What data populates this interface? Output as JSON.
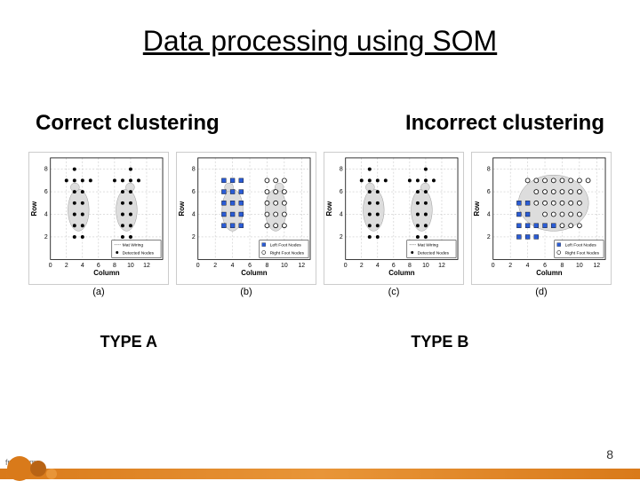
{
  "title": "Data processing using SOM",
  "subtitle_left": "Correct clustering",
  "subtitle_right": "Incorrect clustering",
  "type_a": "TYPE A",
  "type_b": "TYPE B",
  "page_number": "8",
  "attribution": "fppt.com",
  "axes": {
    "xlabel": "Column",
    "ylabel": "Row"
  },
  "legends": {
    "a": [
      "Mat Wiring",
      "Detected Nodes"
    ],
    "b": [
      "Left Foot Nodes",
      "Right Foot Nodes"
    ],
    "c": [
      "Mat Wiring",
      "Detected Nodes"
    ],
    "d": [
      "Left Foot Nodes",
      "Right Foot Nodes"
    ]
  },
  "plot_ids": {
    "a": "(a)",
    "b": "(b)",
    "c": "(c)",
    "d": "(d)"
  },
  "chart_data": [
    {
      "id": "a",
      "type": "scatter",
      "xlabel": "Column",
      "ylabel": "Row",
      "xlim": [
        0,
        14
      ],
      "ylim": [
        0,
        9
      ],
      "xticks": [
        0,
        2,
        4,
        6,
        8,
        10,
        12
      ],
      "yticks": [
        2,
        4,
        6,
        8
      ],
      "series": [
        {
          "name": "Mat Wiring",
          "marker": "line-grid",
          "x": [
            1,
            2,
            3,
            4,
            5,
            6,
            7,
            8,
            9,
            10,
            11,
            12,
            13
          ],
          "y": [
            1,
            2,
            3,
            4,
            5,
            6,
            7,
            8
          ]
        },
        {
          "name": "Detected Nodes (left footprint)",
          "marker": "dot",
          "points": [
            [
              3,
              2
            ],
            [
              4,
              2
            ],
            [
              3,
              3
            ],
            [
              4,
              3
            ],
            [
              3,
              4
            ],
            [
              4,
              4
            ],
            [
              3,
              5
            ],
            [
              4,
              5
            ],
            [
              3,
              6
            ],
            [
              4,
              6
            ],
            [
              3,
              7
            ],
            [
              4,
              7
            ],
            [
              2,
              7
            ],
            [
              3,
              8
            ],
            [
              5,
              7
            ]
          ]
        },
        {
          "name": "Detected Nodes (right footprint)",
          "marker": "dot",
          "points": [
            [
              9,
              2
            ],
            [
              10,
              2
            ],
            [
              9,
              3
            ],
            [
              10,
              3
            ],
            [
              9,
              4
            ],
            [
              10,
              4
            ],
            [
              9,
              5
            ],
            [
              10,
              5
            ],
            [
              9,
              6
            ],
            [
              10,
              6
            ],
            [
              9,
              7
            ],
            [
              10,
              7
            ],
            [
              11,
              7
            ],
            [
              8,
              7
            ],
            [
              10,
              8
            ]
          ]
        }
      ]
    },
    {
      "id": "b",
      "type": "scatter",
      "xlabel": "Column",
      "ylabel": "Row",
      "xlim": [
        0,
        13
      ],
      "ylim": [
        0,
        9
      ],
      "xticks": [
        0,
        2,
        4,
        6,
        8,
        10,
        12
      ],
      "yticks": [
        2,
        4,
        6,
        8
      ],
      "series": [
        {
          "name": "Left Foot Nodes",
          "marker": "square",
          "points": [
            [
              3,
              3
            ],
            [
              4,
              3
            ],
            [
              5,
              3
            ],
            [
              3,
              4
            ],
            [
              4,
              4
            ],
            [
              5,
              4
            ],
            [
              3,
              5
            ],
            [
              4,
              5
            ],
            [
              5,
              5
            ],
            [
              3,
              6
            ],
            [
              4,
              6
            ],
            [
              5,
              6
            ],
            [
              3,
              7
            ],
            [
              4,
              7
            ],
            [
              5,
              7
            ]
          ]
        },
        {
          "name": "Right Foot Nodes",
          "marker": "circle-open",
          "points": [
            [
              8,
              3
            ],
            [
              9,
              3
            ],
            [
              10,
              3
            ],
            [
              8,
              4
            ],
            [
              9,
              4
            ],
            [
              10,
              4
            ],
            [
              8,
              5
            ],
            [
              9,
              5
            ],
            [
              10,
              5
            ],
            [
              8,
              6
            ],
            [
              9,
              6
            ],
            [
              10,
              6
            ],
            [
              8,
              7
            ],
            [
              9,
              7
            ],
            [
              10,
              7
            ]
          ]
        }
      ]
    },
    {
      "id": "c",
      "type": "scatter",
      "xlabel": "Column",
      "ylabel": "Row",
      "xlim": [
        0,
        14
      ],
      "ylim": [
        0,
        9
      ],
      "xticks": [
        0,
        2,
        4,
        6,
        8,
        10,
        12
      ],
      "yticks": [
        2,
        4,
        6,
        8
      ],
      "series": [
        {
          "name": "Mat Wiring",
          "marker": "line-grid",
          "x": [
            1,
            2,
            3,
            4,
            5,
            6,
            7,
            8,
            9,
            10,
            11,
            12,
            13
          ],
          "y": [
            1,
            2,
            3,
            4,
            5,
            6,
            7,
            8
          ]
        },
        {
          "name": "Detected Nodes (left footprint)",
          "marker": "dot",
          "points": [
            [
              3,
              2
            ],
            [
              4,
              2
            ],
            [
              3,
              3
            ],
            [
              4,
              3
            ],
            [
              3,
              4
            ],
            [
              4,
              4
            ],
            [
              3,
              5
            ],
            [
              4,
              5
            ],
            [
              3,
              6
            ],
            [
              4,
              6
            ],
            [
              3,
              7
            ],
            [
              4,
              7
            ],
            [
              2,
              7
            ],
            [
              3,
              8
            ],
            [
              5,
              7
            ]
          ]
        },
        {
          "name": "Detected Nodes (right footprint)",
          "marker": "dot",
          "points": [
            [
              9,
              2
            ],
            [
              10,
              2
            ],
            [
              9,
              3
            ],
            [
              10,
              3
            ],
            [
              9,
              4
            ],
            [
              10,
              4
            ],
            [
              9,
              5
            ],
            [
              10,
              5
            ],
            [
              9,
              6
            ],
            [
              10,
              6
            ],
            [
              9,
              7
            ],
            [
              10,
              7
            ],
            [
              11,
              7
            ],
            [
              8,
              7
            ],
            [
              10,
              8
            ]
          ]
        }
      ]
    },
    {
      "id": "d",
      "type": "scatter",
      "xlabel": "Column",
      "ylabel": "Row",
      "xlim": [
        0,
        13
      ],
      "ylim": [
        0,
        9
      ],
      "xticks": [
        0,
        2,
        4,
        6,
        8,
        10,
        12
      ],
      "yticks": [
        2,
        4,
        6,
        8
      ],
      "series": [
        {
          "name": "Left Foot Nodes",
          "marker": "square",
          "points": [
            [
              3,
              2
            ],
            [
              4,
              2
            ],
            [
              5,
              2
            ],
            [
              6,
              3
            ],
            [
              7,
              3
            ],
            [
              3,
              3
            ],
            [
              4,
              3
            ],
            [
              5,
              3
            ],
            [
              3,
              4
            ],
            [
              4,
              4
            ],
            [
              3,
              5
            ],
            [
              4,
              5
            ]
          ]
        },
        {
          "name": "Right Foot Nodes",
          "marker": "circle-open",
          "points": [
            [
              8,
              3
            ],
            [
              9,
              3
            ],
            [
              10,
              3
            ],
            [
              6,
              4
            ],
            [
              7,
              4
            ],
            [
              8,
              4
            ],
            [
              9,
              4
            ],
            [
              10,
              4
            ],
            [
              5,
              5
            ],
            [
              6,
              5
            ],
            [
              7,
              5
            ],
            [
              8,
              5
            ],
            [
              9,
              5
            ],
            [
              10,
              5
            ],
            [
              5,
              6
            ],
            [
              6,
              6
            ],
            [
              7,
              6
            ],
            [
              8,
              6
            ],
            [
              9,
              6
            ],
            [
              10,
              6
            ],
            [
              4,
              7
            ],
            [
              5,
              7
            ],
            [
              6,
              7
            ],
            [
              7,
              7
            ],
            [
              8,
              7
            ],
            [
              9,
              7
            ],
            [
              10,
              7
            ],
            [
              11,
              7
            ]
          ]
        }
      ]
    }
  ]
}
